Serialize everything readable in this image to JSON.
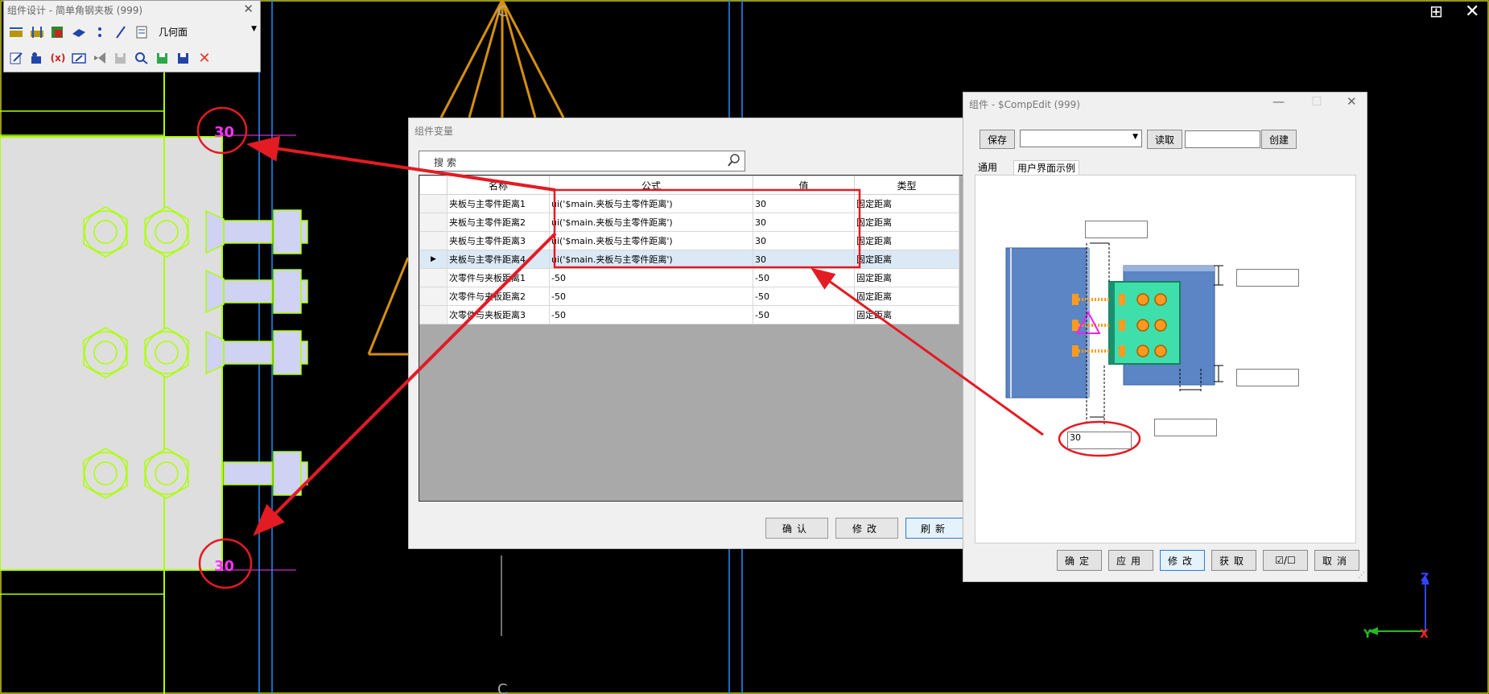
{
  "cad": {
    "dim_top": "30",
    "dim_bottom": "30",
    "axis_z": "Z",
    "axis_y": "Y",
    "axis_x": "X",
    "glyph_top": "C",
    "glyph_bottom": "C",
    "colors": {
      "plate": "#dedede",
      "bolt": "#cfd2f2",
      "outline": "#aaff00",
      "dim_text": "#ff33ff",
      "annotation": "#e31b23",
      "truss": "#d4900f",
      "guide": "#1e90ff"
    }
  },
  "toolbar": {
    "title": "组件设计 - 简单角钢夹板 (999)",
    "close": "✕",
    "view_select": "几何面",
    "row1_icons": [
      "frame-icon",
      "frame-alt-icon",
      "component-icon",
      "plate-icon",
      "point-icon",
      "line-icon",
      "sheet-icon"
    ],
    "row2_icons": [
      "edit-icon",
      "object-icon",
      "variable-icon",
      "draw-icon",
      "visual-studio-icon",
      "save-disabled-icon",
      "browse-icon",
      "save-green-icon",
      "save-as-icon",
      "delete-icon"
    ]
  },
  "main_window": {
    "layout_icon": "⊞",
    "close": "✕"
  },
  "var_dialog": {
    "title": "组件变量",
    "search_placeholder": "搜索",
    "columns": [
      "名称",
      "公式",
      "值",
      "类型"
    ],
    "rows": [
      {
        "name": "夹板与主零件距离1",
        "formula": "ui('$main.夹板与主零件距离')",
        "value": "30",
        "type": "固定距离"
      },
      {
        "name": "夹板与主零件距离2",
        "formula": "ui('$main.夹板与主零件距离')",
        "value": "30",
        "type": "固定距离"
      },
      {
        "name": "夹板与主零件距离3",
        "formula": "ui('$main.夹板与主零件距离')",
        "value": "30",
        "type": "固定距离"
      },
      {
        "name": "夹板与主零件距离4",
        "formula": "ui('$main.夹板与主零件距离')",
        "value": "30",
        "type": "固定距离"
      },
      {
        "name": "次零件与夹板距离1",
        "formula": "-50",
        "value": "-50",
        "type": "固定距离"
      },
      {
        "name": "次零件与夹板距离2",
        "formula": "-50",
        "value": "-50",
        "type": "固定距离"
      },
      {
        "name": "次零件与夹板距离3",
        "formula": "-50",
        "value": "-50",
        "type": "固定距离"
      }
    ],
    "buttons": {
      "confirm": "确认",
      "modify": "修改",
      "refresh": "刷新"
    }
  },
  "ce_dialog": {
    "title": "组件 - $CompEdit (999)",
    "minimize": "—",
    "maximize": "☐",
    "close": "✕",
    "save": "保存",
    "load": "读取",
    "create": "创建",
    "preset_select": "",
    "preset_name": "",
    "tabs": [
      "通用",
      "用户界面示例"
    ],
    "fields": {
      "top": "",
      "right_top": "",
      "right_bottom": "",
      "bottom_right": "",
      "bottom_left": "30"
    },
    "buttons": {
      "ok": "确定",
      "apply": "应用",
      "modify": "修改",
      "get": "获取",
      "toggle": "☑/☐",
      "cancel": "取消"
    }
  }
}
